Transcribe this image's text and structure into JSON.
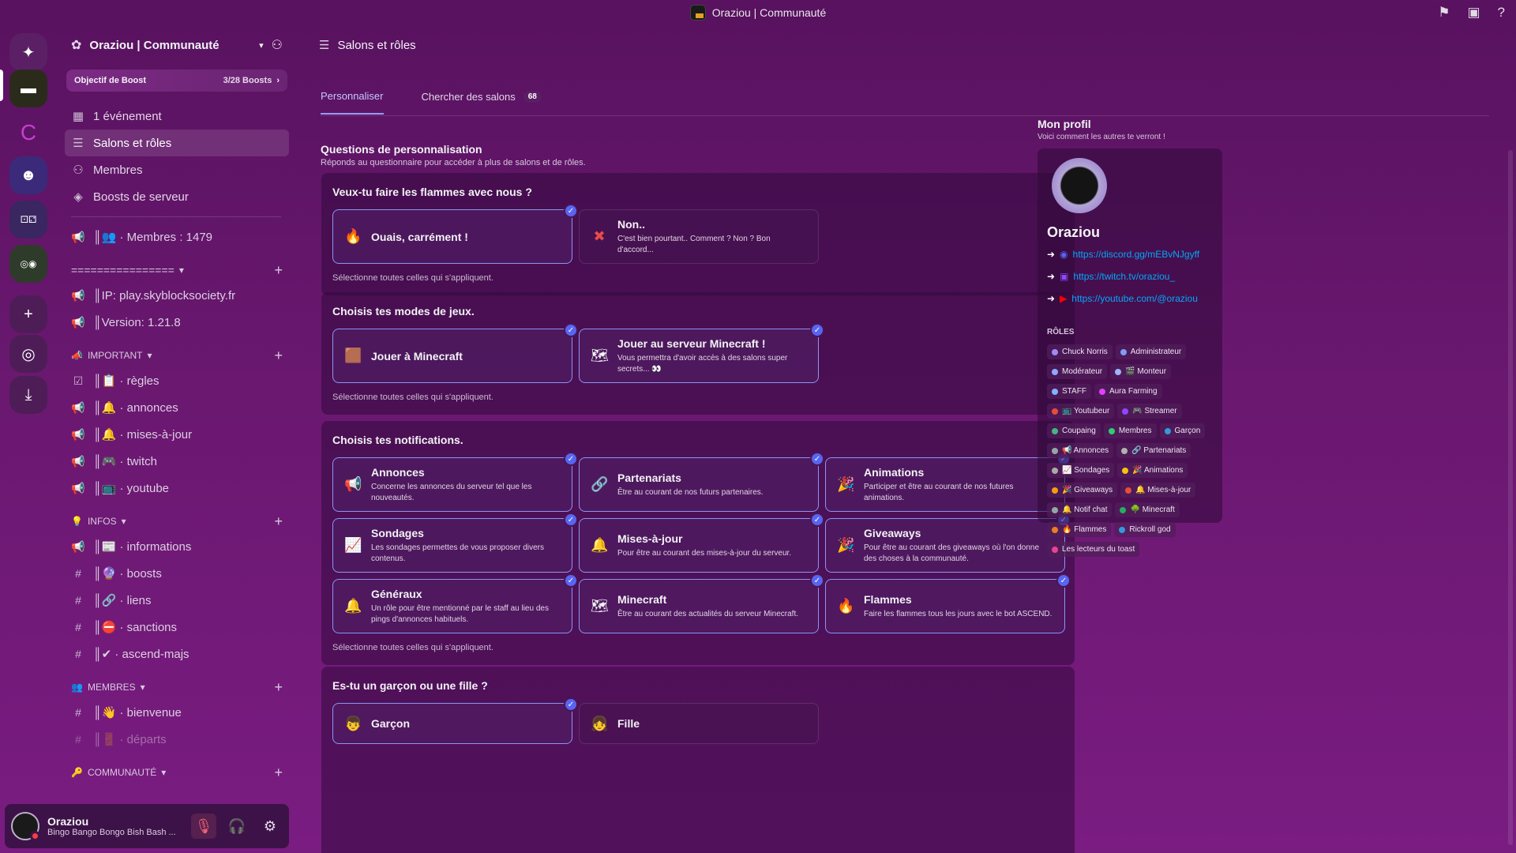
{
  "window": {
    "title": "Oraziou | Communauté"
  },
  "guild": {
    "name": "Oraziou | Communauté",
    "boost_goal": "Objectif de Boost",
    "boost_count": "3/28 Boosts"
  },
  "nav": [
    {
      "label": "1 événement",
      "icon": "calendar-icon"
    },
    {
      "label": "Salons et rôles",
      "icon": "channels-roles-icon"
    },
    {
      "label": "Membres",
      "icon": "members-icon"
    },
    {
      "label": "Boosts de serveur",
      "icon": "boost-icon"
    }
  ],
  "channels_top": [
    {
      "label": "║👥 · Membres : 1479"
    }
  ],
  "sections": [
    {
      "name": "================",
      "items": [
        {
          "label": "║IP: play.skyblocksociety.fr"
        },
        {
          "label": "║Version: 1.21.8"
        }
      ]
    },
    {
      "name": "IMPORTANT",
      "items": [
        {
          "label": "║📋 · règles"
        },
        {
          "label": "║🔔 · annonces"
        },
        {
          "label": "║🔔 · mises-à-jour"
        },
        {
          "label": "║🎮 · twitch"
        },
        {
          "label": "║📺 · youtube"
        }
      ]
    },
    {
      "name": "INFOS",
      "items": [
        {
          "label": "║📰 · informations"
        },
        {
          "label": "║🔮 · boosts"
        },
        {
          "label": "║🔗 · liens"
        },
        {
          "label": "║⛔ · sanctions"
        },
        {
          "label": "║✔ · ascend-majs"
        }
      ]
    },
    {
      "name": "MEMBRES",
      "items": [
        {
          "label": "║👋 · bienvenue"
        },
        {
          "label": "║🚪 · départs"
        }
      ]
    },
    {
      "name": "COMMUNAUTÉ",
      "items": []
    }
  ],
  "user": {
    "name": "Oraziou",
    "status": "Bingo Bango Bongo Bish Bash ..."
  },
  "main": {
    "title": "Salons et rôles",
    "tab_customize": "Personnaliser",
    "tab_browse": "Chercher des salons",
    "tab_browse_count": "68"
  },
  "questions_header": {
    "title": "Questions de personnalisation",
    "subtitle": "Réponds au questionnaire pour accéder à plus de salons et de rôles."
  },
  "questions": [
    {
      "title": "Veux-tu faire les flammes avec nous ?",
      "hint": "Sélectionne toutes celles qui s'appliquent.",
      "options": [
        {
          "title": "Ouais, carrément !",
          "desc": "",
          "icon": "🔥",
          "selected": true
        },
        {
          "title": "Non..",
          "desc": "C'est bien pourtant.. Comment ? Non ? Bon d'accord...",
          "icon": "✖",
          "selected": false
        }
      ]
    },
    {
      "title": "Choisis tes modes de jeux.",
      "hint": "Sélectionne toutes celles qui s'appliquent.",
      "options": [
        {
          "title": "Jouer à Minecraft",
          "desc": "",
          "icon": "🟫",
          "selected": true
        },
        {
          "title": "Jouer au serveur Minecraft !",
          "desc": "Vous permettra d'avoir accès à des salons super secrets... 👀",
          "icon": "🗺",
          "selected": true
        }
      ]
    },
    {
      "title": "Choisis tes notifications.",
      "hint": "Sélectionne toutes celles qui s'appliquent.",
      "options": [
        {
          "title": "Annonces",
          "desc": "Concerne les annonces du serveur tel que les nouveautés.",
          "icon": "📢",
          "selected": true
        },
        {
          "title": "Partenariats",
          "desc": "Être au courant de nos futurs partenaires.",
          "icon": "🔗",
          "selected": true
        },
        {
          "title": "Animations",
          "desc": "Participer et être au courant de nos futures animations.",
          "icon": "🎉",
          "selected": true
        },
        {
          "title": "Sondages",
          "desc": "Les sondages permettes de vous proposer divers contenus.",
          "icon": "📈",
          "selected": true
        },
        {
          "title": "Mises-à-jour",
          "desc": "Pour être au courant des mises-à-jour du serveur.",
          "icon": "🔔",
          "selected": true
        },
        {
          "title": "Giveaways",
          "desc": "Pour être au courant des giveaways où l'on donne des choses à la communauté.",
          "icon": "🎉",
          "selected": true
        },
        {
          "title": "Généraux",
          "desc": "Un rôle pour être mentionné par le staff au lieu des pings d'annonces habituels.",
          "icon": "🔔",
          "selected": true
        },
        {
          "title": "Minecraft",
          "desc": "Être au courant des actualités du serveur Minecraft.",
          "icon": "🗺",
          "selected": true
        },
        {
          "title": "Flammes",
          "desc": "Faire les flammes tous les jours avec le bot ASCEND.",
          "icon": "🔥",
          "selected": true
        }
      ]
    },
    {
      "title": "Es-tu un garçon ou une fille ?",
      "hint": "",
      "options": [
        {
          "title": "Garçon",
          "desc": "",
          "icon": "👦",
          "selected": true
        },
        {
          "title": "Fille",
          "desc": "",
          "icon": "👧",
          "selected": false
        }
      ]
    }
  ],
  "profile": {
    "header": "Mon profil",
    "subheader": "Voici comment les autres te verront !",
    "name": "Oraziou",
    "links": [
      {
        "url": "https://discord.gg/mEBvNJgyff",
        "icon": "discord-icon"
      },
      {
        "url": "https://twitch.tv/oraziou_",
        "icon": "twitch-icon"
      },
      {
        "url": "https://youtube.com/@oraziou",
        "icon": "youtube-icon"
      }
    ],
    "roles_title": "RÔLES",
    "roles": [
      {
        "name": "Chuck Norris",
        "color": "#9b8cf5"
      },
      {
        "name": "Administrateur",
        "color": "#7f9cf5"
      },
      {
        "name": "Modérateur",
        "color": "#8fa8ff"
      },
      {
        "name": "🎬 Monteur",
        "color": "#a0b4ff"
      },
      {
        "name": "STAFF",
        "color": "#7fb2ff"
      },
      {
        "name": "Aura Farming",
        "color": "#e040fb"
      },
      {
        "name": "📺 Youtubeur",
        "color": "#e74c3c"
      },
      {
        "name": "🎮 Streamer",
        "color": "#9146ff"
      },
      {
        "name": "Coupaing",
        "color": "#43b581"
      },
      {
        "name": "Membres",
        "color": "#2ecc71"
      },
      {
        "name": "Garçon",
        "color": "#3498db"
      },
      {
        "name": "📢 Annonces",
        "color": "#95a5a6"
      },
      {
        "name": "🔗 Partenariats",
        "color": "#b0b0b0"
      },
      {
        "name": "📈 Sondages",
        "color": "#aaaaaa"
      },
      {
        "name": "🎉 Animations",
        "color": "#f1c40f"
      },
      {
        "name": "🎉 Giveaways",
        "color": "#f39c12"
      },
      {
        "name": "🔔 Mises-à-jour",
        "color": "#e74c3c"
      },
      {
        "name": "🔔 Notif chat",
        "color": "#95a5a6"
      },
      {
        "name": "🌳 Minecraft",
        "color": "#27ae60"
      },
      {
        "name": "🔥 Flammes",
        "color": "#e67e22"
      },
      {
        "name": "Rickroll god",
        "color": "#3498db"
      },
      {
        "name": "Les lecteurs du toast",
        "color": "#e84393"
      }
    ]
  }
}
